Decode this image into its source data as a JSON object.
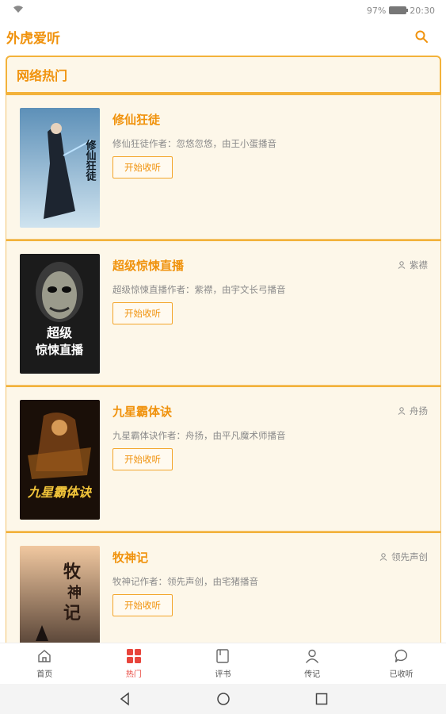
{
  "status_bar": {
    "battery_text": "97%",
    "time": "20:30",
    "battery_level": 0.97
  },
  "app": {
    "title": "外虎爱听"
  },
  "section": {
    "title": "网络热门"
  },
  "books": [
    {
      "title": "修仙狂徒",
      "desc": "修仙狂徒作者：忽悠忽悠，由王小蛋播音",
      "button": "开始收听",
      "author": "",
      "cover_text": "修仙狂徒"
    },
    {
      "title": "超级惊悚直播",
      "desc": "超级惊悚直播作者：紫襟，由宇文长弓播音",
      "button": "开始收听",
      "author": "紫襟",
      "cover_text": "超级惊悚直播"
    },
    {
      "title": "九星霸体诀",
      "desc": "九星霸体诀作者：舟扬，由平凡魔术师播音",
      "button": "开始收听",
      "author": "舟扬",
      "cover_text": "九星霸体诀"
    },
    {
      "title": "牧神记",
      "desc": "牧神记作者：领先声创，由宅猪播音",
      "button": "开始收听",
      "author": "领先声创",
      "cover_text": "牧神记"
    }
  ],
  "nav": [
    {
      "label": "首页",
      "icon": "home-icon"
    },
    {
      "label": "热门",
      "icon": "grid-icon"
    },
    {
      "label": "评书",
      "icon": "book-icon"
    },
    {
      "label": "传记",
      "icon": "person-icon"
    },
    {
      "label": "已收听",
      "icon": "chat-icon"
    }
  ],
  "colors": {
    "accent": "#f0920c",
    "card_bg": "#fdf7e9",
    "border": "#f3b23a",
    "nav_active": "#e8453c"
  }
}
